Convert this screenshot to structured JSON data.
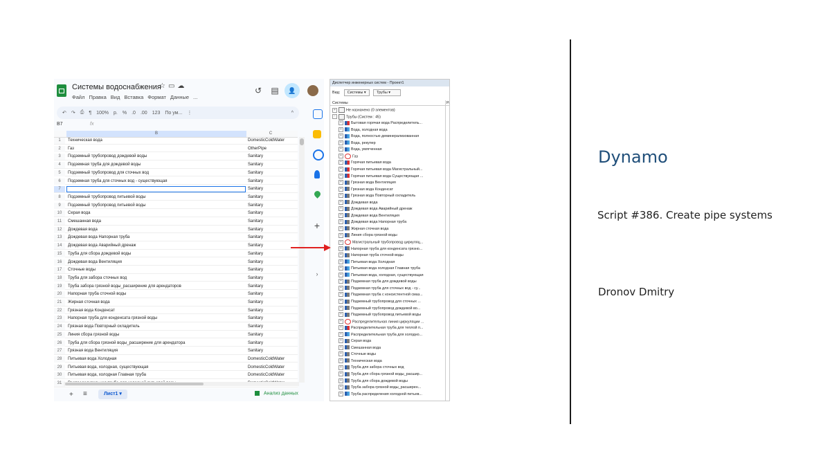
{
  "sheets": {
    "title": "Системы водоснабжения",
    "title_icons": [
      "star-icon",
      "folder-icon",
      "cloud-icon"
    ],
    "menu": [
      "Файл",
      "Правка",
      "Вид",
      "Вставка",
      "Формат",
      "Данные",
      "..."
    ],
    "toolbar": {
      "undo": "↶",
      "redo": "↷",
      "print": "⎙",
      "paint": "¶",
      "zoom": "100%",
      "currency": "р.",
      "percent": "%",
      "dec_dec": ".0",
      "dec_inc": ".00",
      "num123": "123",
      "font": "По ум...",
      "more": "⋮",
      "collapse": "^"
    },
    "cell_ref": "B7",
    "fx": "fx",
    "col_b": "B",
    "col_c": "C",
    "rows": [
      {
        "n": "1",
        "b": "Техническая вода",
        "c": "DomesticColdWater"
      },
      {
        "n": "2",
        "b": "Газ",
        "c": "OtherPipe"
      },
      {
        "n": "3",
        "b": "Подземный трубопровод дождевой воды",
        "c": "Sanitary"
      },
      {
        "n": "4",
        "b": "Подземная труба для дождевой воды",
        "c": "Sanitary"
      },
      {
        "n": "5",
        "b": "Подземный трубопровод для сточных вод",
        "c": "Sanitary"
      },
      {
        "n": "6",
        "b": "Подземная труба для сточных вод - существующая",
        "c": "Sanitary"
      },
      {
        "n": "7",
        "b": "",
        "c": "Sanitary"
      },
      {
        "n": "8",
        "b": "Подземный трубопровод питьевой воды",
        "c": "Sanitary"
      },
      {
        "n": "9",
        "b": "Подземный трубопровод питьевой воды",
        "c": "Sanitary"
      },
      {
        "n": "10",
        "b": "Серая вода",
        "c": "Sanitary"
      },
      {
        "n": "11",
        "b": "Смешанная вода",
        "c": "Sanitary"
      },
      {
        "n": "12",
        "b": "Дождевая вода",
        "c": "Sanitary"
      },
      {
        "n": "13",
        "b": "Дождевая вода Напорная труба",
        "c": "Sanitary"
      },
      {
        "n": "14",
        "b": "Дождевая вода Аварийный дренаж",
        "c": "Sanitary"
      },
      {
        "n": "15",
        "b": "Труба для сбора дождевой воды",
        "c": "Sanitary"
      },
      {
        "n": "16",
        "b": "Дождевая вода Вентиляция",
        "c": "Sanitary"
      },
      {
        "n": "17",
        "b": "Сточные воды",
        "c": "Sanitary"
      },
      {
        "n": "18",
        "b": "Труба для забора сточных вод",
        "c": "Sanitary"
      },
      {
        "n": "19",
        "b": "Труба забора грязной воды_расширение для арендаторов",
        "c": "Sanitary"
      },
      {
        "n": "20",
        "b": "Напорная труба сточной воды",
        "c": "Sanitary"
      },
      {
        "n": "21",
        "b": "Жирная сточная вода",
        "c": "Sanitary"
      },
      {
        "n": "22",
        "b": "Грязная вода Конденсат",
        "c": "Sanitary"
      },
      {
        "n": "23",
        "b": "Напорная труба для конденсата грязной воды",
        "c": "Sanitary"
      },
      {
        "n": "24",
        "b": "Грязная вода Повторный охладитель",
        "c": "Sanitary"
      },
      {
        "n": "25",
        "b": "Линия сбора грязной воды",
        "c": "Sanitary"
      },
      {
        "n": "26",
        "b": "Труба для сбора грязной воды_расширение для арендатора",
        "c": "Sanitary"
      },
      {
        "n": "27",
        "b": "Грязная вода Вентиляция",
        "c": "Sanitary"
      },
      {
        "n": "28",
        "b": "Питьевая вода Холодная",
        "c": "DomesticColdWater"
      },
      {
        "n": "29",
        "b": "Питьевая вода, холодная, существующая",
        "c": "DomesticColdWater"
      },
      {
        "n": "30",
        "b": "Питьевая вода, холодная Главная труба",
        "c": "DomesticColdWater"
      },
      {
        "n": "31",
        "b": "Распределительная труба для холодной питьевой воды",
        "c": "DomesticColdWater"
      }
    ],
    "bottom": {
      "add": "+",
      "list": "≡",
      "tab": "Лист1 ▾",
      "analysis": "Анализ данных"
    }
  },
  "revit": {
    "title": "Диспетчер инженерных систем - Проект1",
    "view_label": "Вид:",
    "view_value": "Системы",
    "filter_value": "Трубы",
    "col_systems": "Системы",
    "col_p": "Ра",
    "items": [
      {
        "level": 0,
        "label": "Не назначено (0 элементов)",
        "icon": "folder"
      },
      {
        "level": 0,
        "label": "Трубы (Систем : 45)",
        "icon": "folder"
      },
      {
        "level": 1,
        "label": "Бытовая горячая вода Распределитель...",
        "icon": "hot"
      },
      {
        "level": 1,
        "label": "Вода, холодная вода",
        "icon": "cold"
      },
      {
        "level": 1,
        "label": "Вода, полностью деминерализованная",
        "icon": "cold"
      },
      {
        "level": 1,
        "label": "Вода, рекупер",
        "icon": "cold"
      },
      {
        "level": 1,
        "label": "Вода, умягченная",
        "icon": "cold"
      },
      {
        "level": 1,
        "label": "Газ",
        "icon": "gas"
      },
      {
        "level": 1,
        "label": "Горячая питьевая вода",
        "icon": "hot"
      },
      {
        "level": 1,
        "label": "Горячая питьевая вода Магистральный...",
        "icon": "hot"
      },
      {
        "level": 1,
        "label": "Горячая питьевая вода Существующая ...",
        "icon": "hot"
      },
      {
        "level": 1,
        "label": "Грязная вода Вентиляция",
        "icon": "san"
      },
      {
        "level": 1,
        "label": "Грязная вода Конденсат",
        "icon": "san"
      },
      {
        "level": 1,
        "label": "Грязная вода Повторный охладитель",
        "icon": "san"
      },
      {
        "level": 1,
        "label": "Дождевая вода",
        "icon": "san"
      },
      {
        "level": 1,
        "label": "Дождевая вода Аварийный дренаж",
        "icon": "san"
      },
      {
        "level": 1,
        "label": "Дождевая вода Вентиляция",
        "icon": "san"
      },
      {
        "level": 1,
        "label": "Дождевая вода Напорная труба",
        "icon": "san"
      },
      {
        "level": 1,
        "label": "Жирная сточная вода",
        "icon": "san"
      },
      {
        "level": 1,
        "label": "Линия сбора грязной воды",
        "icon": "san"
      },
      {
        "level": 1,
        "label": "Магистральный трубопровод циркуляц...",
        "icon": "gas"
      },
      {
        "level": 1,
        "label": "Напорная труба для конденсата грязно...",
        "icon": "san"
      },
      {
        "level": 1,
        "label": "Напорная труба сточной воды",
        "icon": "san"
      },
      {
        "level": 1,
        "label": "Питьевая вода Холодная",
        "icon": "cold"
      },
      {
        "level": 1,
        "label": "Питьевая вода холодная Главная труба",
        "icon": "cold"
      },
      {
        "level": 1,
        "label": "Питьевая вода, холодная, существующая",
        "icon": "cold"
      },
      {
        "level": 1,
        "label": "Подземная труба для дождевой воды",
        "icon": "san"
      },
      {
        "level": 1,
        "label": "Подземная труба для сточных вод - су...",
        "icon": "san"
      },
      {
        "level": 1,
        "label": "Подземная труба с консистентной смаз...",
        "icon": "san"
      },
      {
        "level": 1,
        "label": "Подземный трубопровод для сточных ...",
        "icon": "san"
      },
      {
        "level": 1,
        "label": "Подземный трубопровод дождевой во...",
        "icon": "san"
      },
      {
        "level": 1,
        "label": "Подземный трубопровод питьевой воды",
        "icon": "san"
      },
      {
        "level": 1,
        "label": "Распределительная линия циркуляции ...",
        "icon": "gas"
      },
      {
        "level": 1,
        "label": "Распределительная труба для теплой п...",
        "icon": "hot"
      },
      {
        "level": 1,
        "label": "Распределительная труба для холодно...",
        "icon": "cold"
      },
      {
        "level": 1,
        "label": "Серая вода",
        "icon": "san"
      },
      {
        "level": 1,
        "label": "Смешанная вода",
        "icon": "san"
      },
      {
        "level": 1,
        "label": "Сточные воды",
        "icon": "san"
      },
      {
        "level": 1,
        "label": "Техническая вода",
        "icon": "san"
      },
      {
        "level": 1,
        "label": "Труба для забора сточных вод",
        "icon": "san"
      },
      {
        "level": 1,
        "label": "Труба для сбора грязной воды_расшир...",
        "icon": "san"
      },
      {
        "level": 1,
        "label": "Труба для сбора дождевой воды",
        "icon": "san"
      },
      {
        "level": 1,
        "label": "Труба забора грязной воды_расширен...",
        "icon": "san"
      },
      {
        "level": 1,
        "label": "Труба распределения холодной питьев...",
        "icon": "cold"
      }
    ]
  },
  "info": {
    "title": "Dynamo",
    "script": "Script #386. Create pipe systems",
    "author": "Dronov Dmitry"
  },
  "colors": {
    "accent_title": "#1f4e79",
    "arrow": "#e02020",
    "selection": "#1a73e8"
  }
}
